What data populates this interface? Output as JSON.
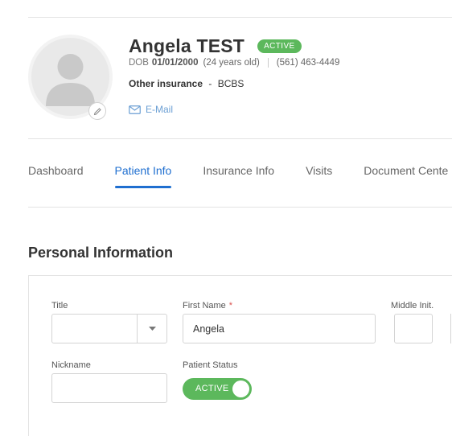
{
  "patient": {
    "name": "Angela TEST",
    "status": "ACTIVE",
    "dob_label": "DOB",
    "dob": "01/01/2000",
    "age": "(24 years old)",
    "phone": "(561) 463-4449",
    "insurance_label": "Other insurance",
    "insurance_separator": "-",
    "insurance_value": "BCBS",
    "email_label": "E-Mail"
  },
  "tabs": [
    {
      "label": "Dashboard",
      "active": false
    },
    {
      "label": "Patient Info",
      "active": true
    },
    {
      "label": "Insurance Info",
      "active": false
    },
    {
      "label": "Visits",
      "active": false
    },
    {
      "label": "Document Cente",
      "active": false
    }
  ],
  "section": {
    "title": "Personal Information"
  },
  "form": {
    "title_label": "Title",
    "title_value": "",
    "first_name_label": "First Name",
    "first_name_required": "*",
    "first_name_value": "Angela",
    "middle_init_label": "Middle Init.",
    "middle_init_value": "",
    "nickname_label": "Nickname",
    "nickname_value": "",
    "patient_status_label": "Patient Status",
    "patient_status_value": "ACTIVE"
  },
  "colors": {
    "accent": "#1f6fd0",
    "active_green": "#5cb85c",
    "link": "#6b9fd4",
    "required": "#d9534f"
  },
  "icons": {
    "avatar": "user-silhouette-icon",
    "edit": "pencil-icon",
    "email": "envelope-icon",
    "select": "caret-down-icon"
  }
}
